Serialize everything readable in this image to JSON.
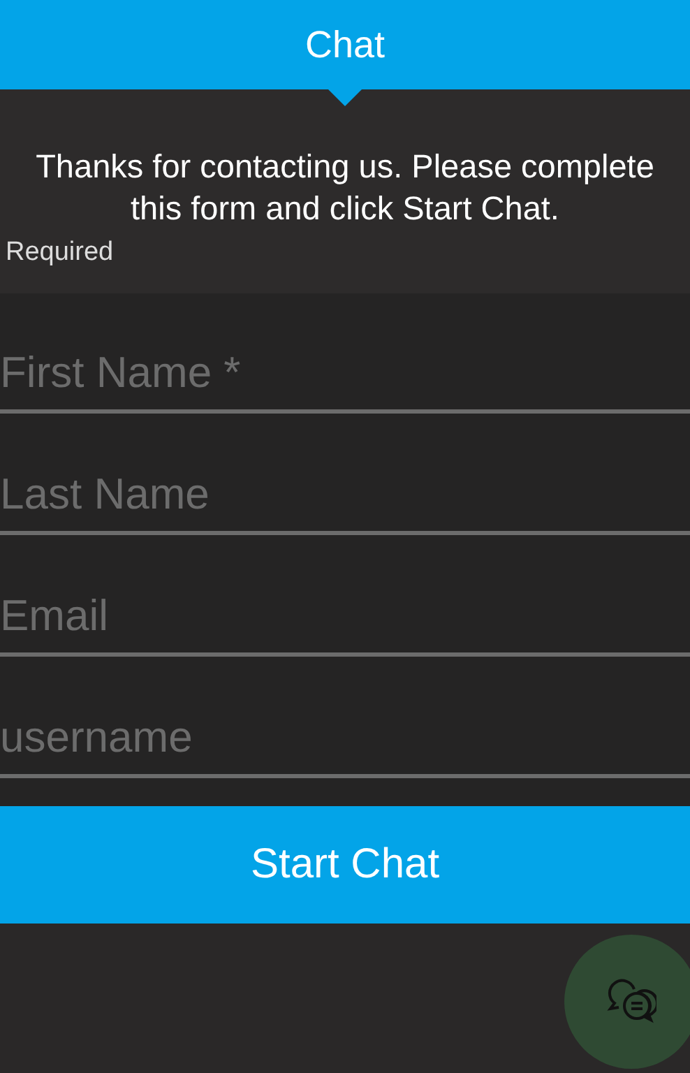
{
  "header": {
    "title": "Chat"
  },
  "intro": {
    "message": "Thanks for contacting us. Please complete this form and click Start Chat.",
    "note": "Required"
  },
  "fields": [
    {
      "placeholder": "First Name *"
    },
    {
      "placeholder": "Last Name"
    },
    {
      "placeholder": "Email"
    },
    {
      "placeholder": "username"
    }
  ],
  "submit": {
    "label": "Start Chat"
  }
}
